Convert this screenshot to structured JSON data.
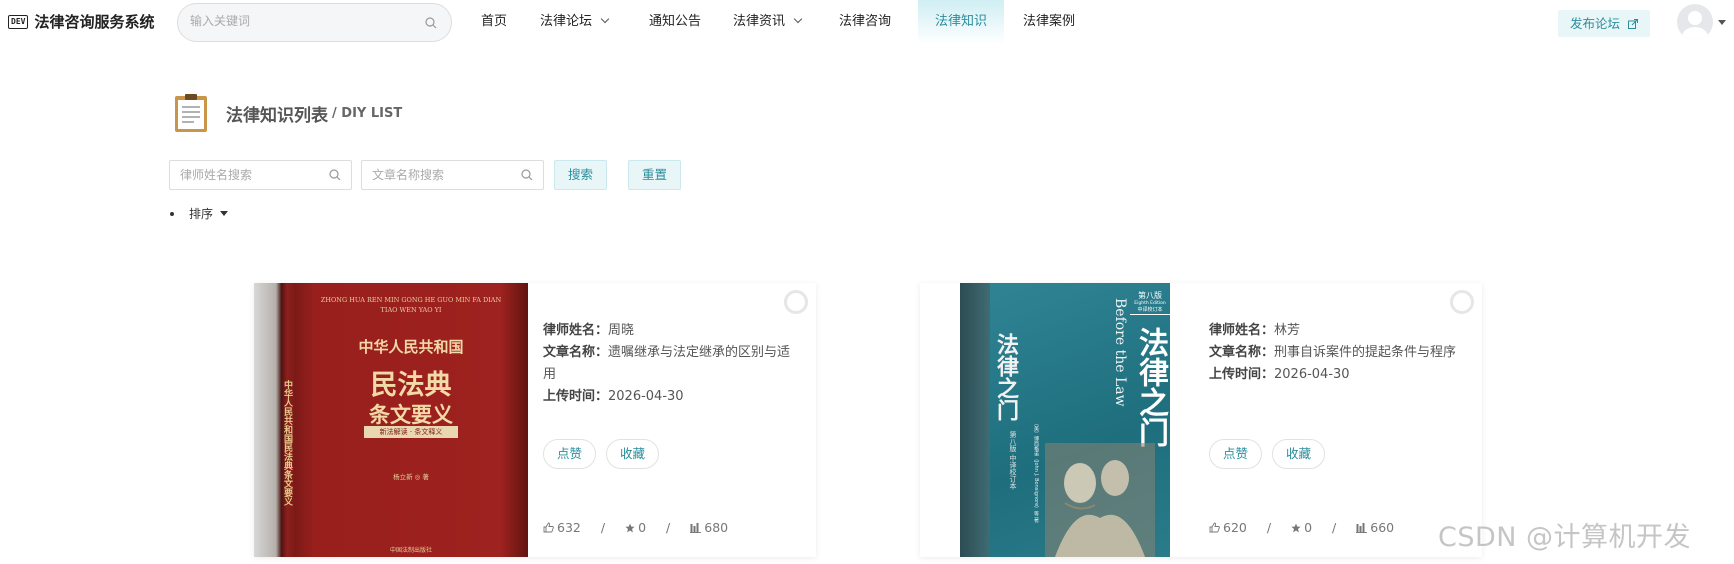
{
  "header": {
    "logo_text": "DEV",
    "app_name": "法律咨询服务系统",
    "search_placeholder": "输入关键词",
    "nav": [
      {
        "label": "首页"
      },
      {
        "label": "法律论坛"
      },
      {
        "label": "通知公告"
      },
      {
        "label": "法律资讯"
      },
      {
        "label": "法律咨询"
      },
      {
        "label": "法律知识"
      },
      {
        "label": "法律案例"
      }
    ],
    "active_nav": "法律知识",
    "publish_label": "发布论坛"
  },
  "page": {
    "title": "法律知识列表",
    "subtitle": "/ DIY LIST"
  },
  "filters": {
    "lawyer_placeholder": "律师姓名搜索",
    "article_placeholder": "文章名称搜索",
    "search_label": "搜索",
    "reset_label": "重置",
    "sort_label": "排序"
  },
  "labels": {
    "lawyer": "律师姓名：",
    "article": "文章名称：",
    "upload": "上传时间：",
    "like": "点赞",
    "collect": "收藏",
    "sep": "/"
  },
  "cards": [
    {
      "lawyer": "周晓",
      "article": "遗嘱继承与法定继承的区别与适用",
      "date": "2026-04-30",
      "likes": "632",
      "stars": "0",
      "views": "680",
      "cover": {
        "pinyin1": "ZHONG HUA REN MIN GONG HE GUO MIN FA DIAN",
        "pinyin2": "TIAO WEN YAO YI",
        "line1": "中华人民共和国",
        "line2": "民法典",
        "line3": "条文要义",
        "tag": "新法解读 · 条文释义",
        "author": "杨立新 ◎ 著",
        "spine": "中华人民共和国民法典条文要义",
        "publisher": "中国法制出版社"
      }
    },
    {
      "lawyer": "林芳",
      "article": "刑事自诉案件的提起条件与程序",
      "date": "2026-04-30",
      "likes": "620",
      "stars": "0",
      "views": "660",
      "cover": {
        "edition": "第八版",
        "edition_en": "Eighth Edition",
        "series": "中译校订本",
        "en_title": "Before the Law",
        "title": "法律之门",
        "spine": "法律之门",
        "author": "〔美〕博西格诺（John J. Bonsignore）等 著",
        "spine_ed": "第八版 中译校订本"
      }
    }
  ],
  "watermark": "CSDN @计算机开发",
  "colors": {
    "accent": "#2a8d9c",
    "accent_bg": "#e9f6f8"
  }
}
